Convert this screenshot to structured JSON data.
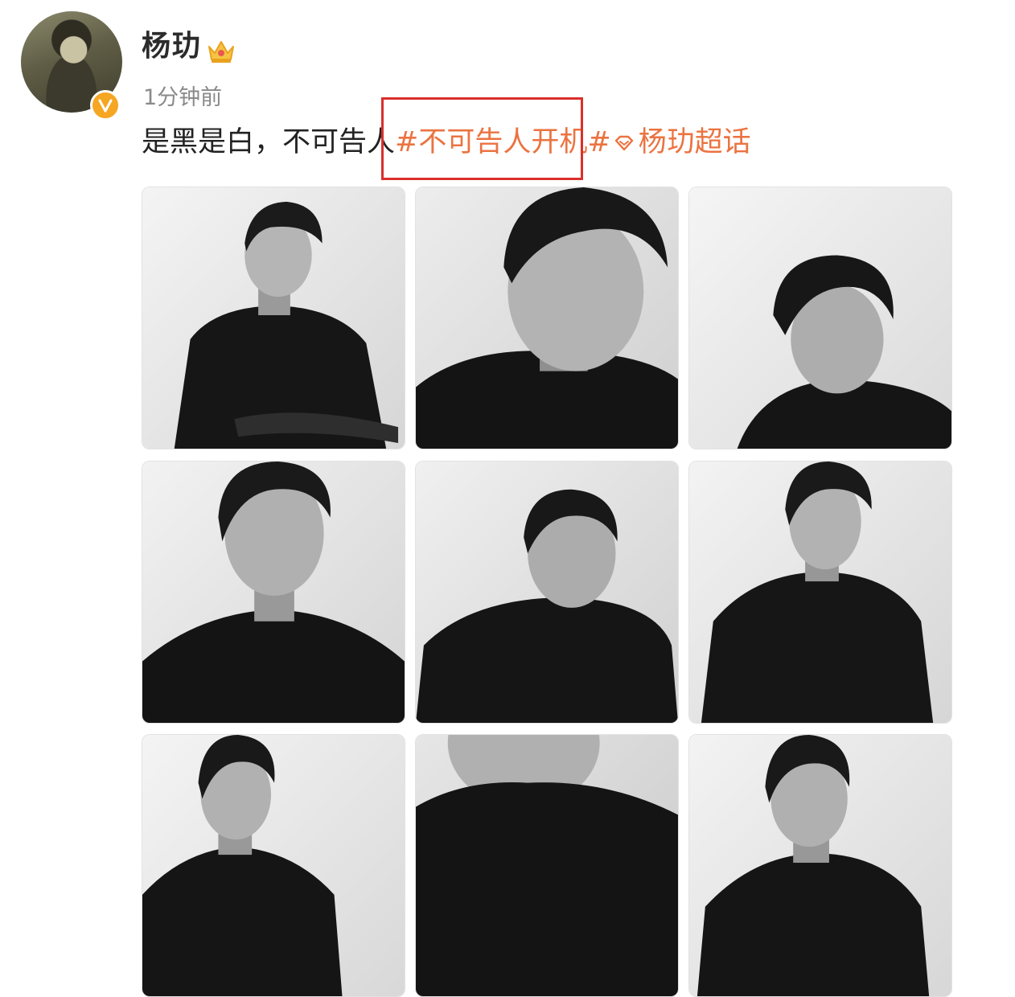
{
  "post": {
    "author": {
      "name": "杨玏",
      "verified": true,
      "badge_color": "#f5a623",
      "crown_icon": "crown-icon"
    },
    "timestamp": "1分钟前",
    "text": {
      "body": "是黑是白，不可告人",
      "hashtag": "#不可告人开机#",
      "supertopic_icon": "supertopic-diamond-icon",
      "supertopic": "杨玏超话"
    },
    "highlight_color": "#d9302c",
    "link_color": "#eb7340",
    "photos": [
      "photo-1",
      "photo-2",
      "photo-3",
      "photo-4",
      "photo-5",
      "photo-6",
      "photo-7",
      "photo-8",
      "photo-9"
    ]
  }
}
